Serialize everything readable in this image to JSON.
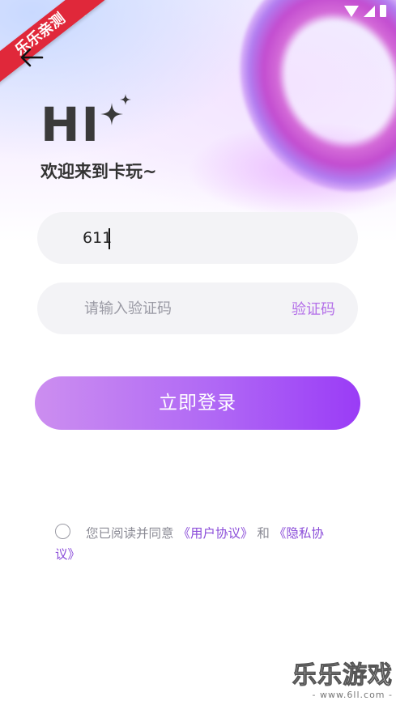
{
  "ribbon": "乐乐亲测",
  "hero": {
    "title": "HI",
    "welcome": "欢迎来到卡玩~"
  },
  "phone_field": {
    "value": "611"
  },
  "code_field": {
    "placeholder": "请输入验证码",
    "get_code_label": "验证码"
  },
  "login_button": "立即登录",
  "agreement": {
    "prefix": "您已阅读并同意",
    "user_agreement": "《用户协议》",
    "conjunction": "和",
    "privacy_prefix": "《隐私协",
    "privacy_suffix": "议》"
  },
  "watermark": {
    "main": "乐乐游戏",
    "sub": "- www.6ll.com -"
  },
  "colors": {
    "accent": "#9a3cf6",
    "link": "#8b4dd9",
    "code_link": "#b36ee8",
    "ribbon": "#e0283a"
  },
  "icons": {
    "back": "arrow-left-icon",
    "sparkle": "sparkle-icon",
    "wifi": "wifi-icon",
    "signal": "signal-icon",
    "battery": "battery-icon",
    "keyboard": "keyboard-icon"
  }
}
